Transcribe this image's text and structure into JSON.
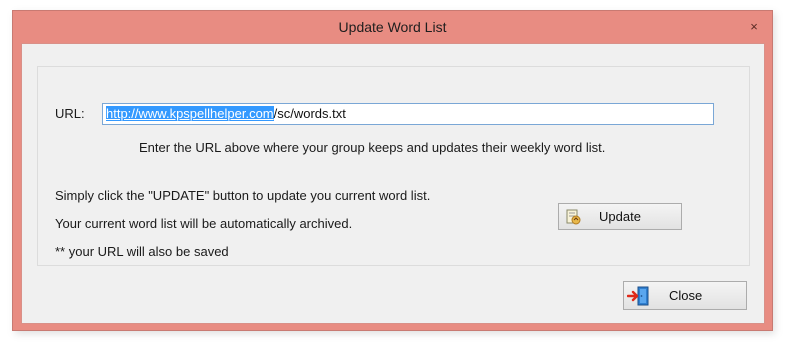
{
  "window": {
    "title": "Update Word List",
    "close_glyph": "×"
  },
  "form": {
    "url_label": "URL:",
    "url_value_selected": "http://www.kpspellhelper.com",
    "url_value_rest": "/sc/words.txt",
    "url_hint": "Enter the URL above where your group keeps and updates their weekly word list.",
    "instruction_1": "Simply click the \"UPDATE\" button to update you current word list.",
    "instruction_2": "Your current word list will be automatically archived.",
    "instruction_3": "** your URL will also be saved"
  },
  "buttons": {
    "update_label": "Update",
    "update_icon": "document-refresh-icon",
    "close_label": "Close",
    "close_icon": "exit-door-icon"
  },
  "colors": {
    "titlebar": "#e88c82",
    "client_bg": "#f0f0f0",
    "selection": "#3399ff"
  }
}
